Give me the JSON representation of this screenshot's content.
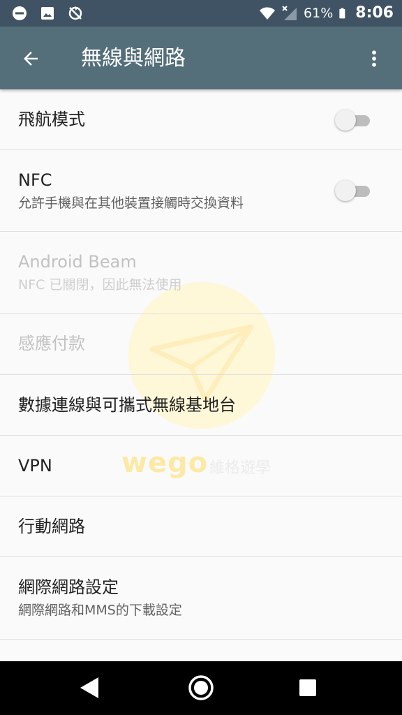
{
  "status_bar": {
    "left_icons": [
      "do-not-disturb-icon",
      "image-icon",
      "no-sync-icon"
    ],
    "right_icons": [
      "wifi-icon",
      "signal-no-service-icon",
      "battery-icon"
    ],
    "battery": "61%",
    "time": "8:06"
  },
  "app_bar": {
    "title": "無線與網路",
    "back_icon": "arrow-back-icon",
    "menu_icon": "more-vert-icon"
  },
  "settings": [
    {
      "title": "飛航模式",
      "switch_on": false
    },
    {
      "title": "NFC",
      "summary": "允許手機與在其他裝置接觸時交換資料",
      "switch_on": false
    },
    {
      "title": "Android Beam",
      "summary": "NFC 已關閉，因此無法使用",
      "enabled": false
    },
    {
      "title": "感應付款",
      "enabled": false
    },
    {
      "title": "數據連線與可攜式無線基地台"
    },
    {
      "title": "VPN"
    },
    {
      "title": "行動網路"
    },
    {
      "title": "網際網路設定",
      "summary": "網際網路和MMS的下載設定"
    }
  ],
  "watermark": {
    "brand": "wego",
    "text": "維格遊學"
  },
  "nav_bar": {
    "icons": [
      "back-triangle-icon",
      "home-circle-icon",
      "recents-square-icon"
    ]
  },
  "colors": {
    "status_bar": "#3f5364",
    "app_bar": "#546e7a",
    "background": "#fafafa",
    "divider": "#e0e0e0",
    "watermark": "#fde9a6"
  }
}
